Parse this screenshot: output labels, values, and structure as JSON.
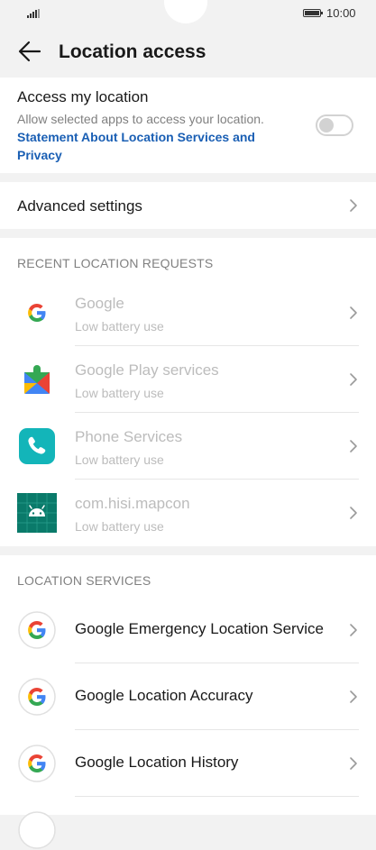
{
  "status_bar": {
    "time": "10:00"
  },
  "header": {
    "title": "Location access"
  },
  "access": {
    "title": "Access my location",
    "description": "Allow selected apps to access your location.",
    "link": "Statement About Location Services and Privacy",
    "toggle_on": false
  },
  "advanced": {
    "label": "Advanced settings"
  },
  "recent": {
    "header": "RECENT LOCATION REQUESTS",
    "items": [
      {
        "name": "Google",
        "sub": "Low battery use",
        "icon": "google-icon"
      },
      {
        "name": "Google Play services",
        "sub": "Low battery use",
        "icon": "google-play-services-icon"
      },
      {
        "name": "Phone Services",
        "sub": "Low battery use",
        "icon": "phone-services-icon"
      },
      {
        "name": "com.hisi.mapcon",
        "sub": "Low battery use",
        "icon": "android-icon"
      }
    ]
  },
  "services": {
    "header": "LOCATION SERVICES",
    "items": [
      {
        "name": "Google Emergency Location Service",
        "icon": "google-icon"
      },
      {
        "name": "Google Location Accuracy",
        "icon": "google-icon"
      },
      {
        "name": "Google Location History",
        "icon": "google-icon"
      }
    ]
  },
  "colors": {
    "link": "#1a5fb4",
    "background": "#f2f2f2",
    "card": "#ffffff"
  }
}
